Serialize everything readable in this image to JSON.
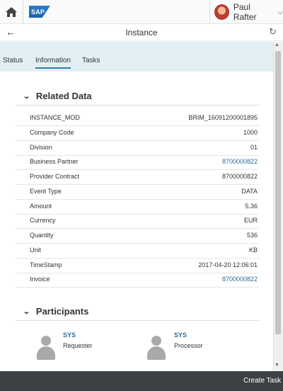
{
  "shell": {
    "user_name": "Paul Rafter",
    "logo_text": "SAP",
    "home_icon": "home-icon",
    "caret_icon": "chevron-down-icon"
  },
  "header": {
    "title": "Instance",
    "back_icon": "arrow-left-icon",
    "refresh_icon": "refresh-icon"
  },
  "tabs": [
    {
      "label": "Status"
    },
    {
      "label": "Information"
    },
    {
      "label": "Tasks"
    }
  ],
  "related": {
    "title": "Related Data",
    "rows": [
      {
        "label": "INSTANCE_MOD",
        "value": "BRIM_16091200001895"
      },
      {
        "label": "Company Code",
        "value": "1000"
      },
      {
        "label": "Division",
        "value": "01"
      },
      {
        "label": "Business Partner",
        "value": "8700000822"
      },
      {
        "label": "Provider Contract",
        "value": "8700000822"
      },
      {
        "label": "Event Type",
        "value": "DATA"
      },
      {
        "label": "Amount",
        "value": "5.36"
      },
      {
        "label": "Currency",
        "value": "EUR"
      },
      {
        "label": "Quantity",
        "value": "536"
      },
      {
        "label": "Unit",
        "value": "KB"
      },
      {
        "label": "TimeStamp",
        "value": "2017-04-20 12:06:01"
      },
      {
        "label": "Invoice",
        "value": "8700000822"
      }
    ]
  },
  "participants": {
    "title": "Participants",
    "items": [
      {
        "name": "SYS",
        "role": "Requester"
      },
      {
        "name": "SYS",
        "role": "Processor"
      }
    ]
  },
  "footer": {
    "create_task_label": "Create Task"
  },
  "colors": {
    "link": "#2a6d9e",
    "tabbar_bg": "#e2eff5",
    "footer_bg": "#3d4145"
  }
}
